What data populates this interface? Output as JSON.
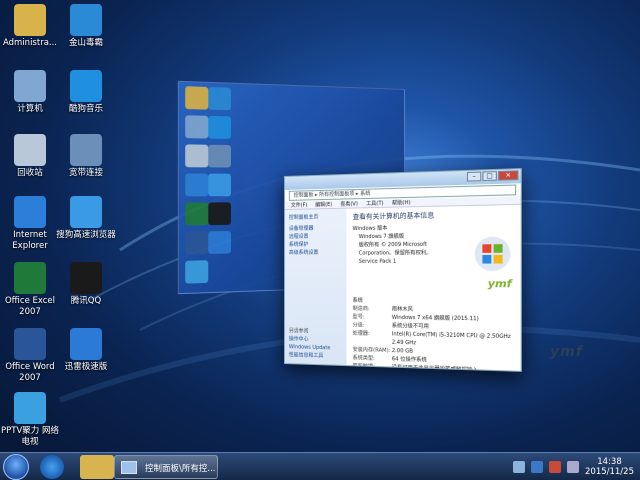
{
  "desktop": {
    "icons": [
      {
        "label": "Administra...",
        "icon": "user-folder-icon",
        "color": "#d8b24a"
      },
      {
        "label": "金山毒霸",
        "icon": "kingsoft-antivirus-icon",
        "color": "#2a8ad6"
      },
      {
        "label": "计算机",
        "icon": "computer-icon",
        "color": "#7fa7d1"
      },
      {
        "label": "酷狗音乐",
        "icon": "kugou-music-icon",
        "color": "#1f8fe0"
      },
      {
        "label": "回收站",
        "icon": "recycle-bin-icon",
        "color": "#b9c8d8"
      },
      {
        "label": "宽带连接",
        "icon": "broadband-connection-icon",
        "color": "#6b8fb8"
      },
      {
        "label": "Internet Explorer",
        "icon": "internet-explorer-icon",
        "color": "#2b7fd8"
      },
      {
        "label": "搜狗高速浏览器",
        "icon": "sogou-browser-icon",
        "color": "#3a9ae6"
      },
      {
        "label": "Office Excel 2007",
        "icon": "excel-icon",
        "color": "#1f7a3a"
      },
      {
        "label": "腾讯QQ",
        "icon": "qq-penguin-icon",
        "color": "#1a1a1a"
      },
      {
        "label": "Office Word 2007",
        "icon": "word-icon",
        "color": "#2a5699"
      },
      {
        "label": "迅雷极速版",
        "icon": "thunder-download-icon",
        "color": "#2a7ad6"
      },
      {
        "label": "PPTV聚力 网络电视",
        "icon": "pptv-icon",
        "color": "#3aa0e0"
      }
    ]
  },
  "window": {
    "address": "控制面板 ▸ 所有控制面板项 ▸ 系统",
    "search_placeholder": "搜索控制面板",
    "menu": [
      "文件(F)",
      "编辑(E)",
      "查看(V)",
      "工具(T)",
      "帮助(H)"
    ],
    "left_title": "控制面板主页",
    "left_links": [
      "设备管理器",
      "远程设置",
      "系统保护",
      "高级系统设置"
    ],
    "left_see_also": "另请参阅",
    "left_bottom": [
      "操作中心",
      "Windows Update",
      "性能信息和工具"
    ],
    "heading": "查看有关计算机的基本信息",
    "edition_header": "Windows 版本",
    "edition": "Windows 7 旗舰版",
    "copyright": "版权所有 © 2009 Microsoft Corporation。保留所有权利。",
    "service_pack": "Service Pack 1",
    "system_header": "系统",
    "rows": [
      {
        "k": "制造商:",
        "v": "雨林木风"
      },
      {
        "k": "型号:",
        "v": "Windows 7 x64 旗舰版 (2015.11)"
      },
      {
        "k": "分级:",
        "v": "系统分级不可用"
      },
      {
        "k": "处理器:",
        "v": "Intel(R) Core(TM) i5-3210M CPU @ 2.50GHz 2.49 GHz"
      },
      {
        "k": "安装内存(RAM):",
        "v": "2.00 GB"
      },
      {
        "k": "系统类型:",
        "v": "64 位操作系统"
      },
      {
        "k": "笔和触摸:",
        "v": "没有可用于此显示器的笔或触控输入"
      }
    ],
    "brand": "ymf"
  },
  "desk_brand": "ymf",
  "taskbar": {
    "open_window_label": "控制面板\\所有控...",
    "time": "14:38",
    "date": "2015/11/25"
  },
  "colors": {
    "accent": "#1f55a8",
    "taskbar": "#142848"
  }
}
